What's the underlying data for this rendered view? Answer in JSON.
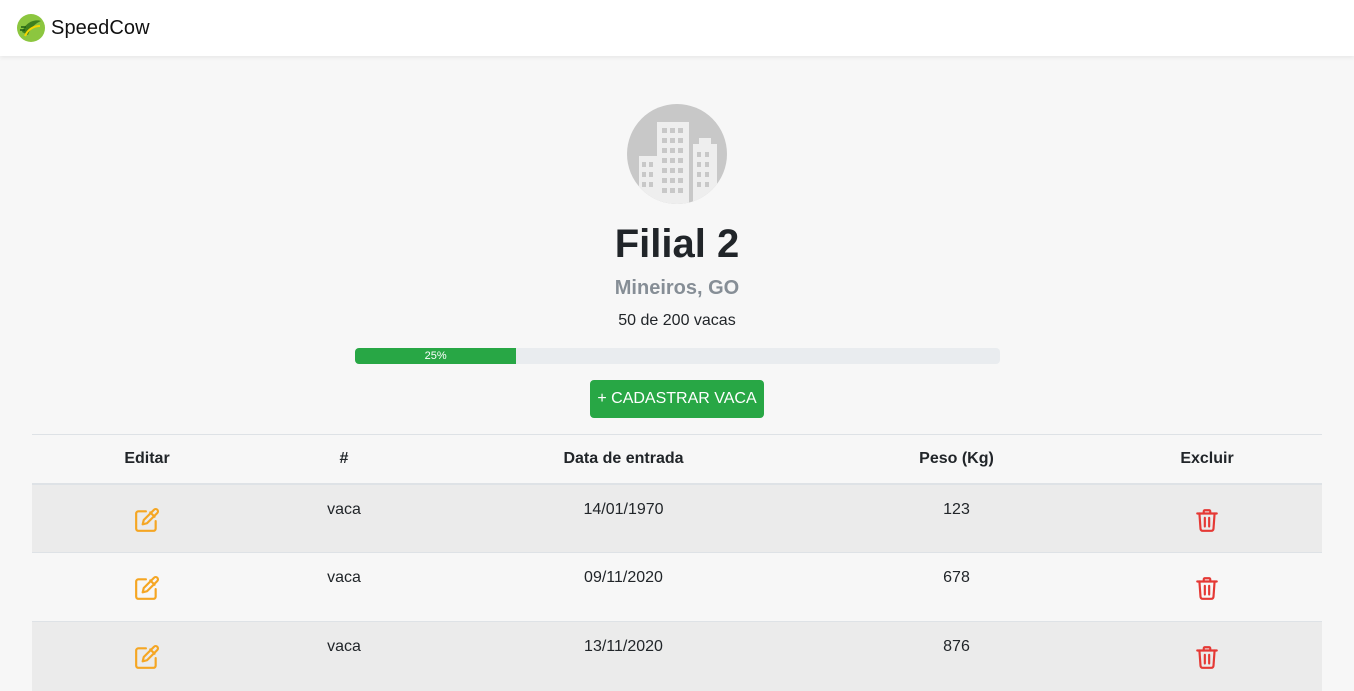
{
  "navbar": {
    "brand": "SpeedCow"
  },
  "farm": {
    "name": "Filial 2",
    "location": "Mineiros, GO",
    "count_text": "50 de 200 vacas",
    "progress_label": "25%",
    "progress_value": 25
  },
  "actions": {
    "add_cow": "+ CADASTRAR VACA"
  },
  "table": {
    "headers": [
      "Editar",
      "#",
      "Data de entrada",
      "Peso (Kg)",
      "Excluir"
    ],
    "rows": [
      {
        "name": "vaca",
        "date": "14/01/1970",
        "weight": "123"
      },
      {
        "name": "vaca",
        "date": "09/11/2020",
        "weight": "678"
      },
      {
        "name": "vaca",
        "date": "13/11/2020",
        "weight": "876"
      }
    ]
  },
  "colors": {
    "accent": "#28a745",
    "edit": "#f5a623",
    "delete": "#e53935"
  },
  "icons": {
    "edit": "edit-icon",
    "delete": "trash-icon",
    "avatar": "building-icon"
  }
}
